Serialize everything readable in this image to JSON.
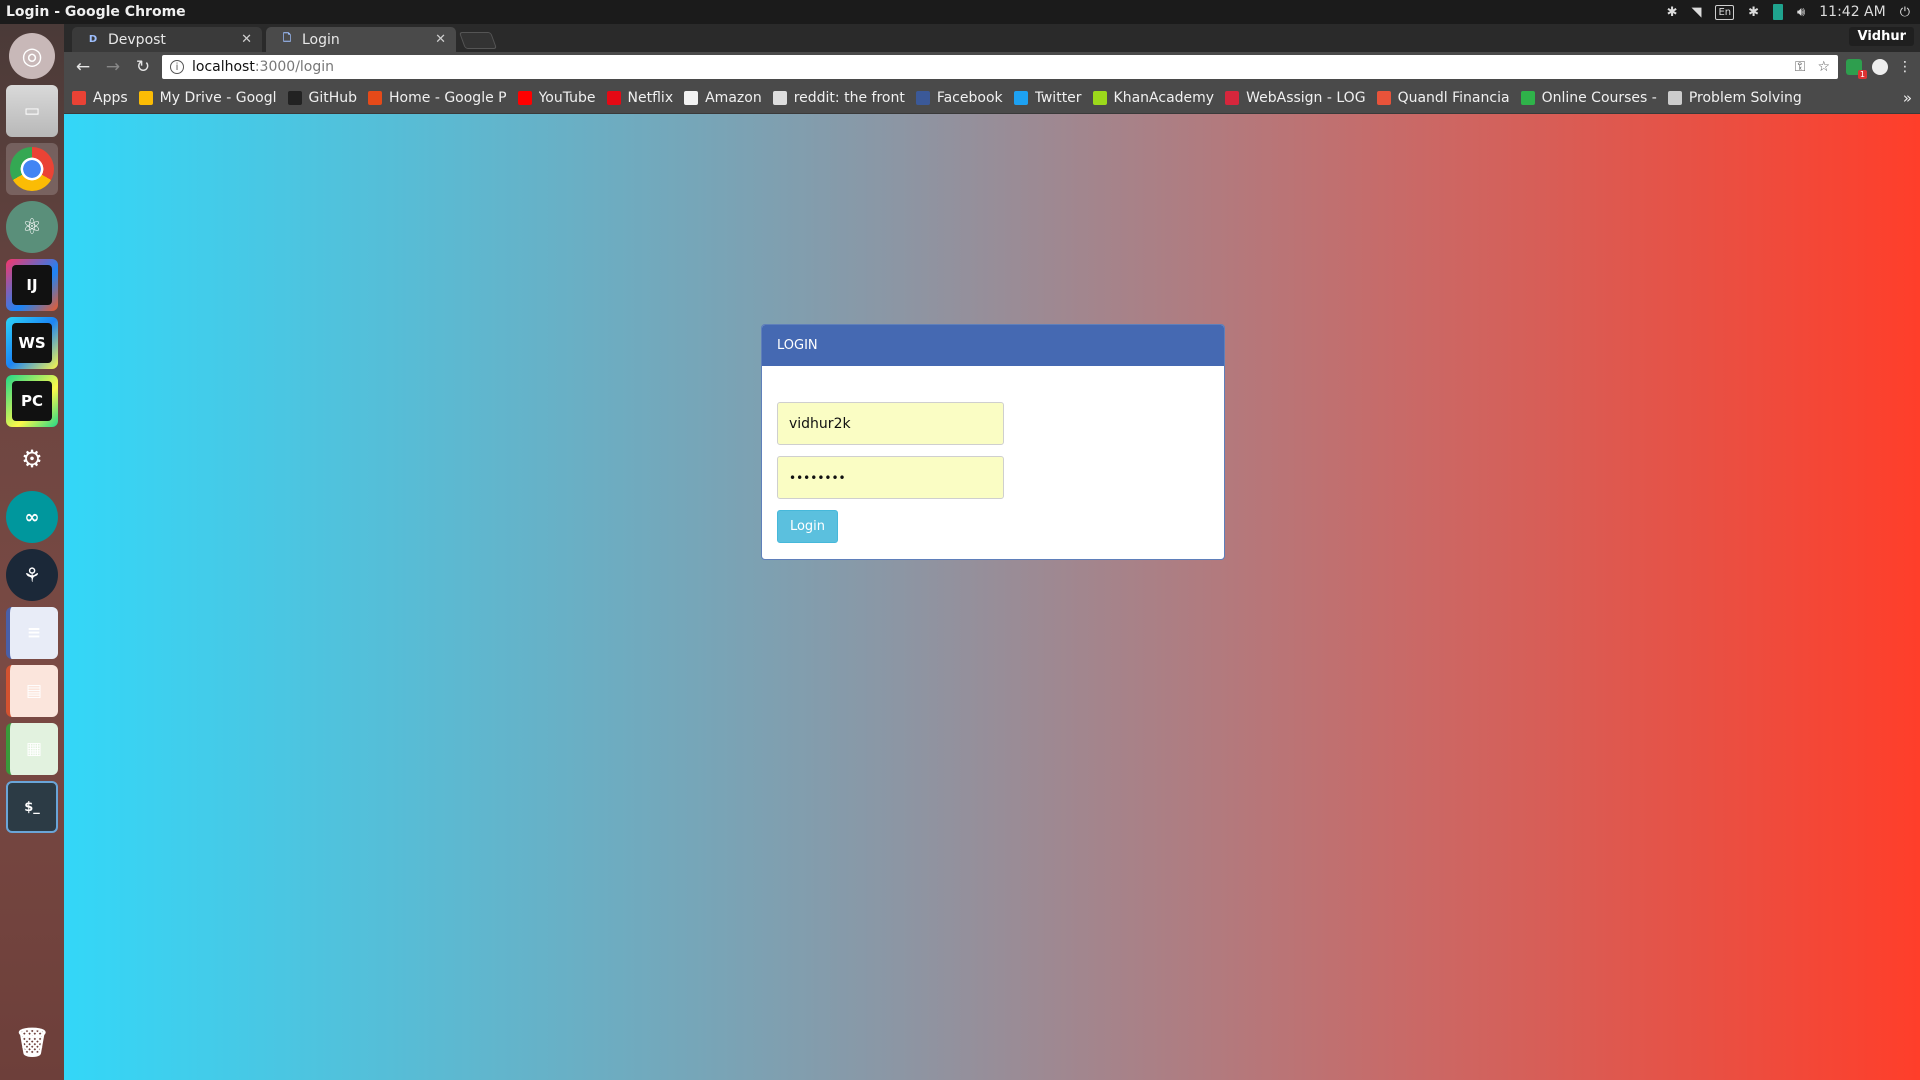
{
  "window": {
    "title": "Login - Google Chrome"
  },
  "panel": {
    "language": "En",
    "clock": "11:42 AM"
  },
  "launcher": {
    "apps": [
      {
        "name": "dash"
      },
      {
        "name": "files"
      },
      {
        "name": "chrome"
      },
      {
        "name": "atom"
      },
      {
        "name": "intellij-idea",
        "glyph": "IJ"
      },
      {
        "name": "webstorm",
        "glyph": "WS"
      },
      {
        "name": "pycharm",
        "glyph": "PC"
      },
      {
        "name": "android-studio"
      },
      {
        "name": "arduino"
      },
      {
        "name": "steam"
      },
      {
        "name": "libreoffice-writer"
      },
      {
        "name": "libreoffice-impress"
      },
      {
        "name": "libreoffice-calc"
      },
      {
        "name": "terminal",
        "glyph": "$_"
      },
      {
        "name": "trash"
      }
    ]
  },
  "browser": {
    "profile": "Vidhur",
    "tabs": [
      {
        "favicon": "D",
        "label": "Devpost",
        "active": false
      },
      {
        "favicon": "",
        "label": "Login",
        "active": true
      }
    ],
    "omnibox": {
      "host": "localhost",
      "path": ":3000/login"
    },
    "bookmarks": [
      {
        "label": "Apps",
        "color": "#e94235"
      },
      {
        "label": "My Drive - Googl",
        "color": "#fbbc05"
      },
      {
        "label": "GitHub",
        "color": "#222222"
      },
      {
        "label": "Home - Google P",
        "color": "#e64a19"
      },
      {
        "label": "YouTube",
        "color": "#ff0000"
      },
      {
        "label": "Netflix",
        "color": "#e50914"
      },
      {
        "label": "Amazon",
        "color": "#f2f2f2"
      },
      {
        "label": "reddit: the front",
        "color": "#dddddd"
      },
      {
        "label": "Facebook",
        "color": "#3b5998"
      },
      {
        "label": "Twitter",
        "color": "#1da1f2"
      },
      {
        "label": "KhanAcademy",
        "color": "#9cd91b"
      },
      {
        "label": "WebAssign - LOG",
        "color": "#d6263c"
      },
      {
        "label": "Quandl Financia",
        "color": "#e8533a"
      },
      {
        "label": "Online Courses -",
        "color": "#2fb34a"
      },
      {
        "label": "Problem Solving",
        "color": "#cccccc"
      }
    ]
  },
  "login": {
    "header": "LOGIN",
    "username": "vidhur2k",
    "password_mask": "••••••••",
    "button": "Login",
    "colors": {
      "header_bg": "#4569b2",
      "button_bg": "#5bc0de",
      "input_bg": "#fafdc4"
    }
  }
}
